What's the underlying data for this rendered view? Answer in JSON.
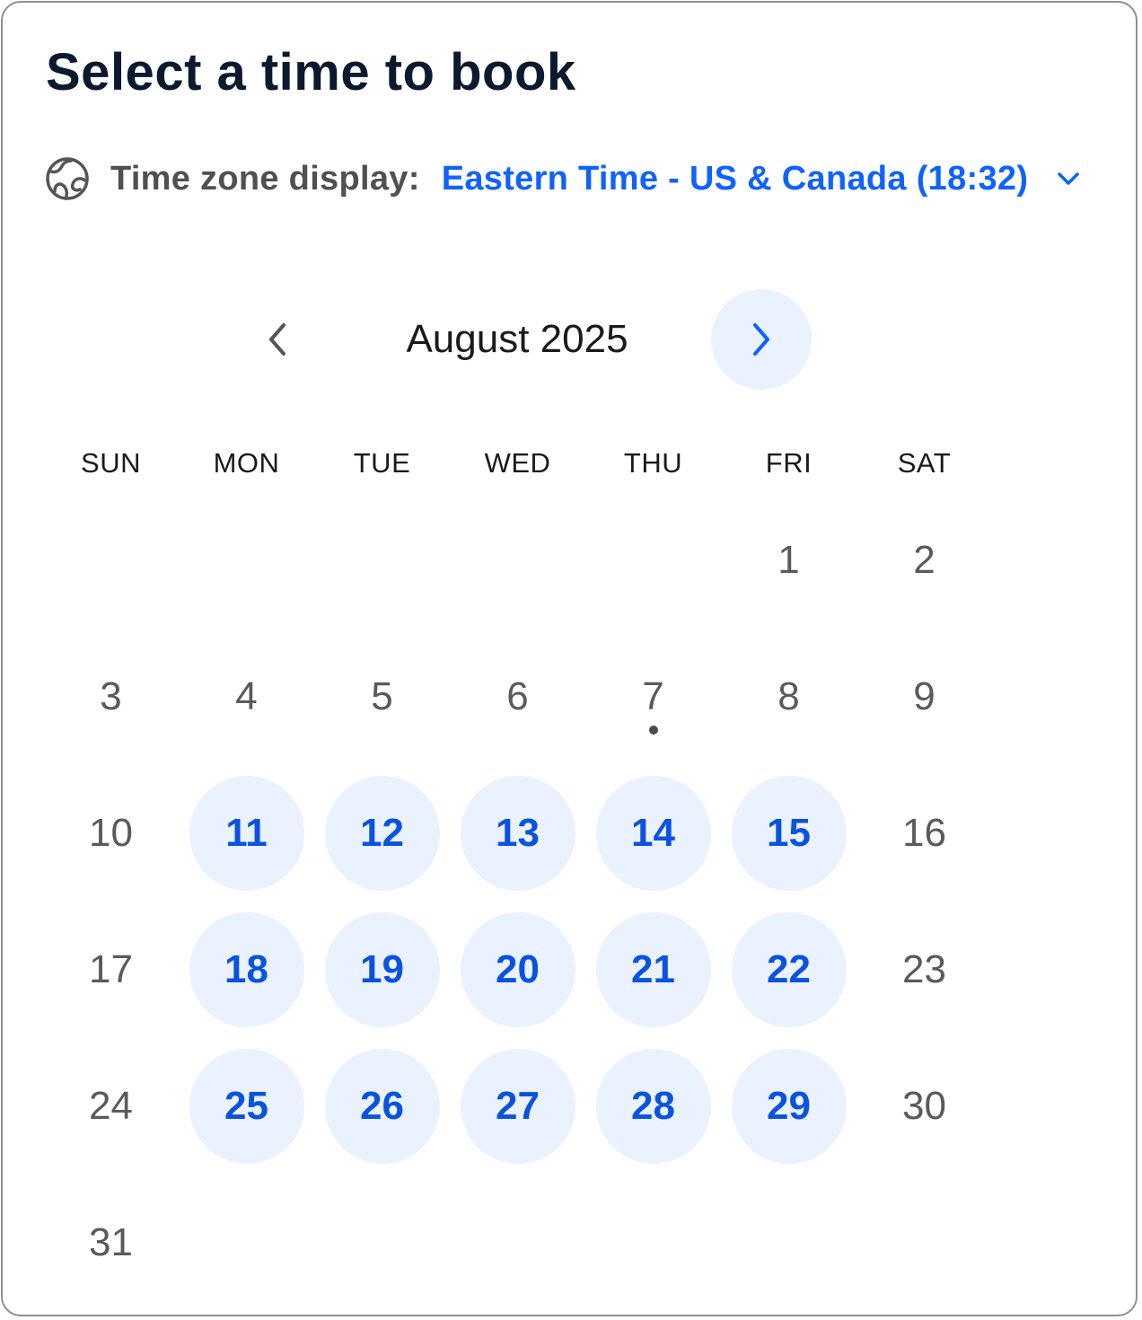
{
  "header": {
    "title": "Select a time to book"
  },
  "timezone": {
    "icon": "globe-icon",
    "label": "Time zone display:",
    "value": "Eastern Time - US & Canada (18:32)",
    "dropdown_icon": "chevron-down-icon"
  },
  "calendar": {
    "month_label": "August 2025",
    "prev_icon": "chevron-left-icon",
    "next_icon": "chevron-right-icon",
    "weekdays": [
      "SUN",
      "MON",
      "TUE",
      "WED",
      "THU",
      "FRI",
      "SAT"
    ],
    "first_weekday_index": 5,
    "days": [
      {
        "label": "1",
        "available": false
      },
      {
        "label": "2",
        "available": false
      },
      {
        "label": "3",
        "available": false
      },
      {
        "label": "4",
        "available": false
      },
      {
        "label": "5",
        "available": false
      },
      {
        "label": "6",
        "available": false
      },
      {
        "label": "7",
        "available": false,
        "today": true
      },
      {
        "label": "8",
        "available": false
      },
      {
        "label": "9",
        "available": false
      },
      {
        "label": "10",
        "available": false
      },
      {
        "label": "11",
        "available": true
      },
      {
        "label": "12",
        "available": true
      },
      {
        "label": "13",
        "available": true
      },
      {
        "label": "14",
        "available": true
      },
      {
        "label": "15",
        "available": true
      },
      {
        "label": "16",
        "available": false
      },
      {
        "label": "17",
        "available": false
      },
      {
        "label": "18",
        "available": true
      },
      {
        "label": "19",
        "available": true
      },
      {
        "label": "20",
        "available": true
      },
      {
        "label": "21",
        "available": true
      },
      {
        "label": "22",
        "available": true
      },
      {
        "label": "23",
        "available": false
      },
      {
        "label": "24",
        "available": false
      },
      {
        "label": "25",
        "available": true
      },
      {
        "label": "26",
        "available": true
      },
      {
        "label": "27",
        "available": true
      },
      {
        "label": "28",
        "available": true
      },
      {
        "label": "29",
        "available": true
      },
      {
        "label": "30",
        "available": false
      },
      {
        "label": "31",
        "available": false
      }
    ]
  },
  "colors": {
    "accent": "#0f62fe",
    "available_text": "#0a52e0",
    "available_bg": "#eaf2ff",
    "unavailable_text": "#5a5a5a",
    "title_text": "#0b1a2e",
    "border": "#8f8f8f"
  }
}
